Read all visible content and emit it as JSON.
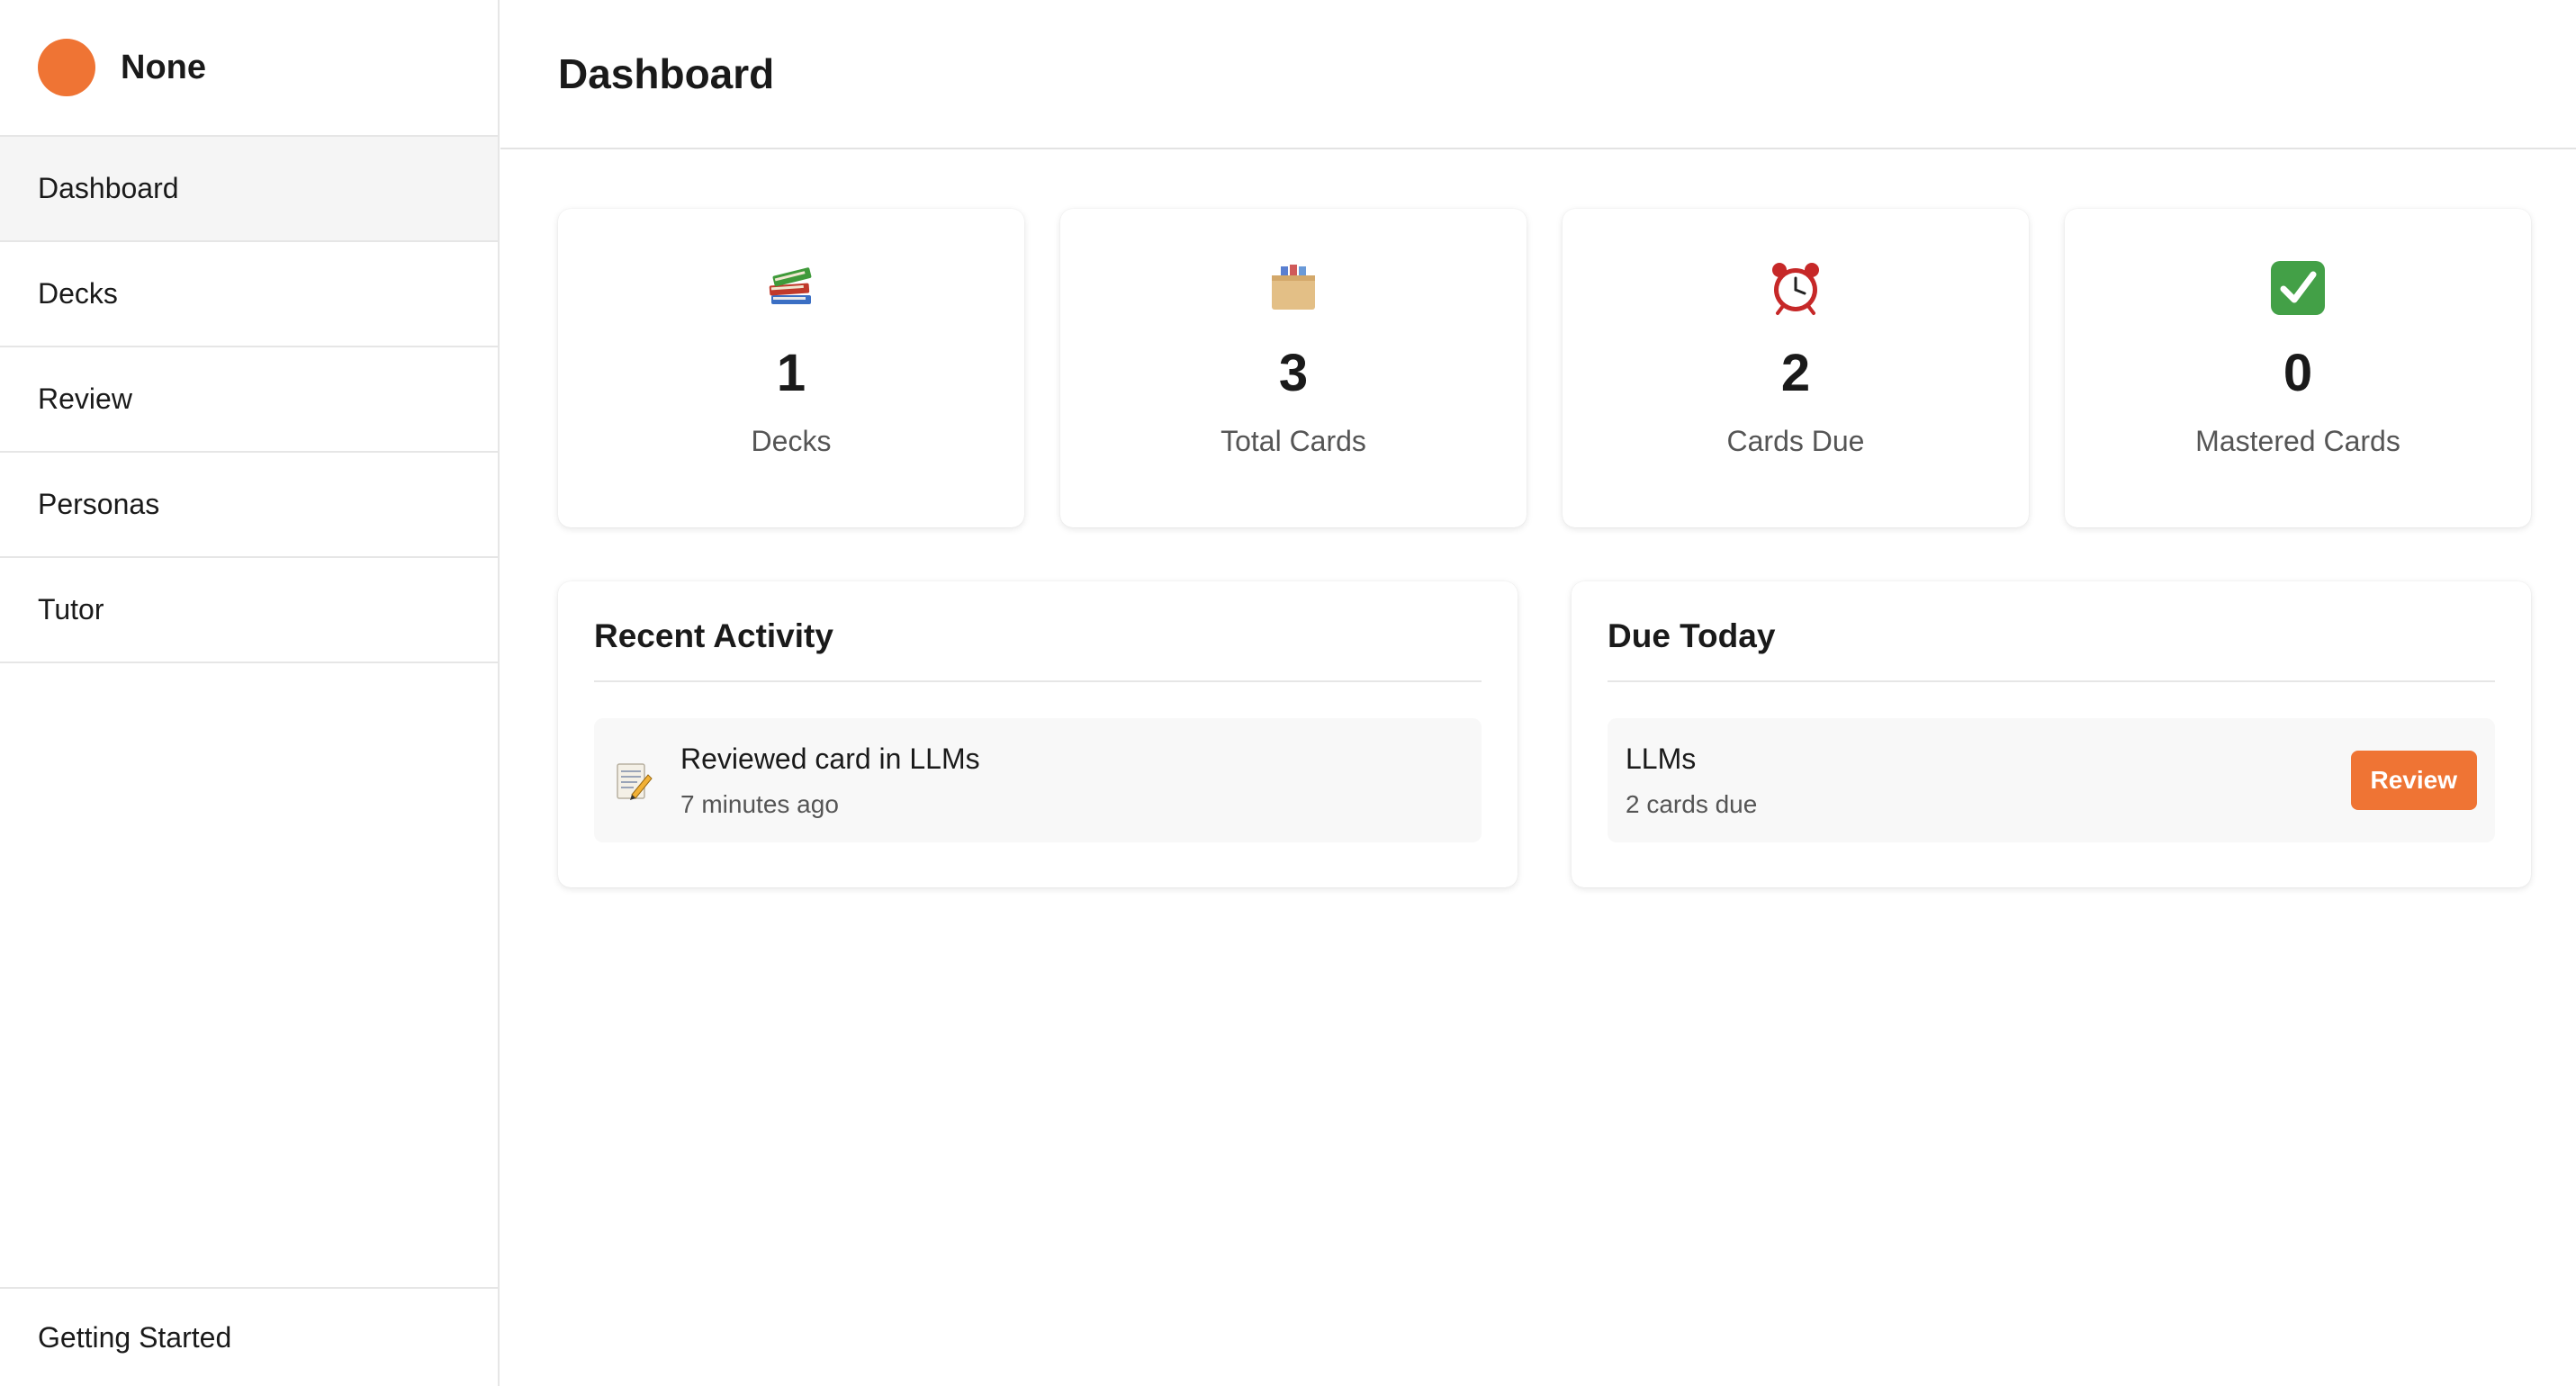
{
  "brand": {
    "name": "None",
    "accent": "#ef7434"
  },
  "sidebar": {
    "items": [
      {
        "label": "Dashboard",
        "active": true
      },
      {
        "label": "Decks"
      },
      {
        "label": "Review"
      },
      {
        "label": "Personas"
      },
      {
        "label": "Tutor"
      }
    ],
    "footer_label": "Getting Started"
  },
  "header": {
    "title": "Dashboard"
  },
  "stats": [
    {
      "icon": "books-icon",
      "value": "1",
      "label": "Decks"
    },
    {
      "icon": "card-file-box-icon",
      "value": "3",
      "label": "Total Cards"
    },
    {
      "icon": "alarm-clock-icon",
      "value": "2",
      "label": "Cards Due"
    },
    {
      "icon": "check-mark-icon",
      "value": "0",
      "label": "Mastered Cards"
    }
  ],
  "recent_activity": {
    "title": "Recent Activity",
    "items": [
      {
        "icon": "memo-icon",
        "text": "Reviewed card in LLMs",
        "time": "7 minutes ago"
      }
    ]
  },
  "due_today": {
    "title": "Due Today",
    "items": [
      {
        "deck": "LLMs",
        "due": "2 cards due",
        "button_label": "Review"
      }
    ]
  }
}
